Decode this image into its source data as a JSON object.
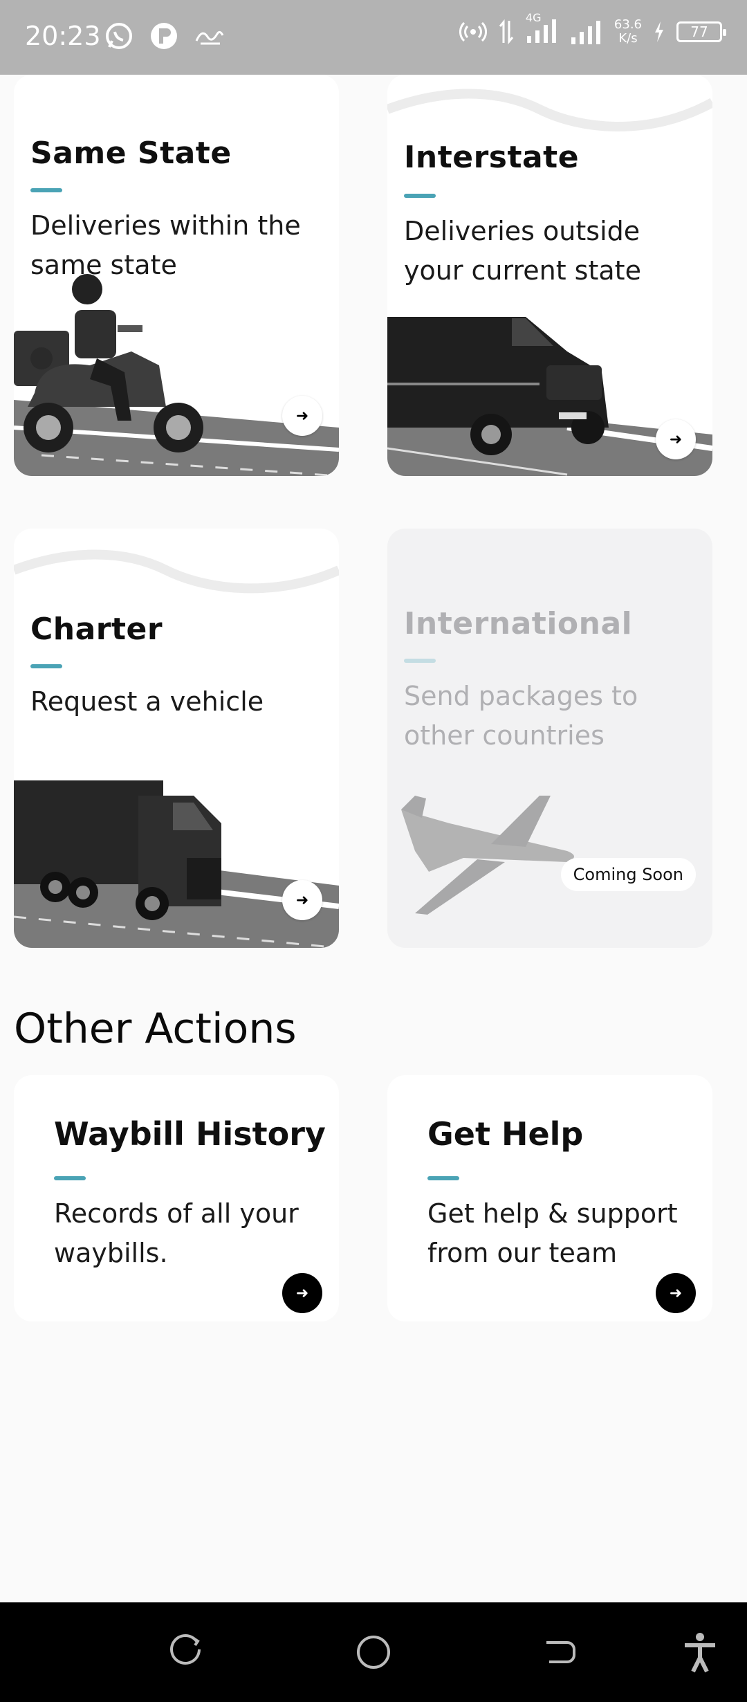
{
  "status_bar": {
    "time": "20:23",
    "network": "4G",
    "speed_value": "63.6",
    "speed_unit": "K/s",
    "battery": "77",
    "icons_left": [
      "whatsapp-icon",
      "app-icon",
      "signature-icon"
    ],
    "icons_right": [
      "hotspot-icon",
      "data-arrows-icon",
      "signal-icon",
      "signal-icon",
      "charging-icon",
      "battery-icon"
    ]
  },
  "delivery_options": [
    {
      "title": "Same State",
      "description": "Deliveries within the same state",
      "vehicle": "scooter",
      "enabled": true
    },
    {
      "title": "Interstate",
      "description": "Deliveries outside your current state",
      "vehicle": "van",
      "enabled": true
    },
    {
      "title": "Charter",
      "description": "Request a vehicle",
      "vehicle": "truck",
      "enabled": true
    },
    {
      "title": "International",
      "description": "Send packages to other countries",
      "vehicle": "airplane",
      "enabled": false,
      "badge": "Coming Soon"
    }
  ],
  "other_actions": {
    "heading": "Other Actions",
    "items": [
      {
        "title": "Waybill History",
        "description": "Records of all your waybills."
      },
      {
        "title": "Get Help",
        "description": "Get help & support from our team"
      }
    ]
  },
  "colors": {
    "accent": "#4aa3b5",
    "status_bar": "#b3b3b3",
    "background": "#fafafa"
  },
  "nav_bar": {
    "icons": [
      "recents-icon",
      "home-icon",
      "back-icon",
      "accessibility-icon"
    ]
  }
}
